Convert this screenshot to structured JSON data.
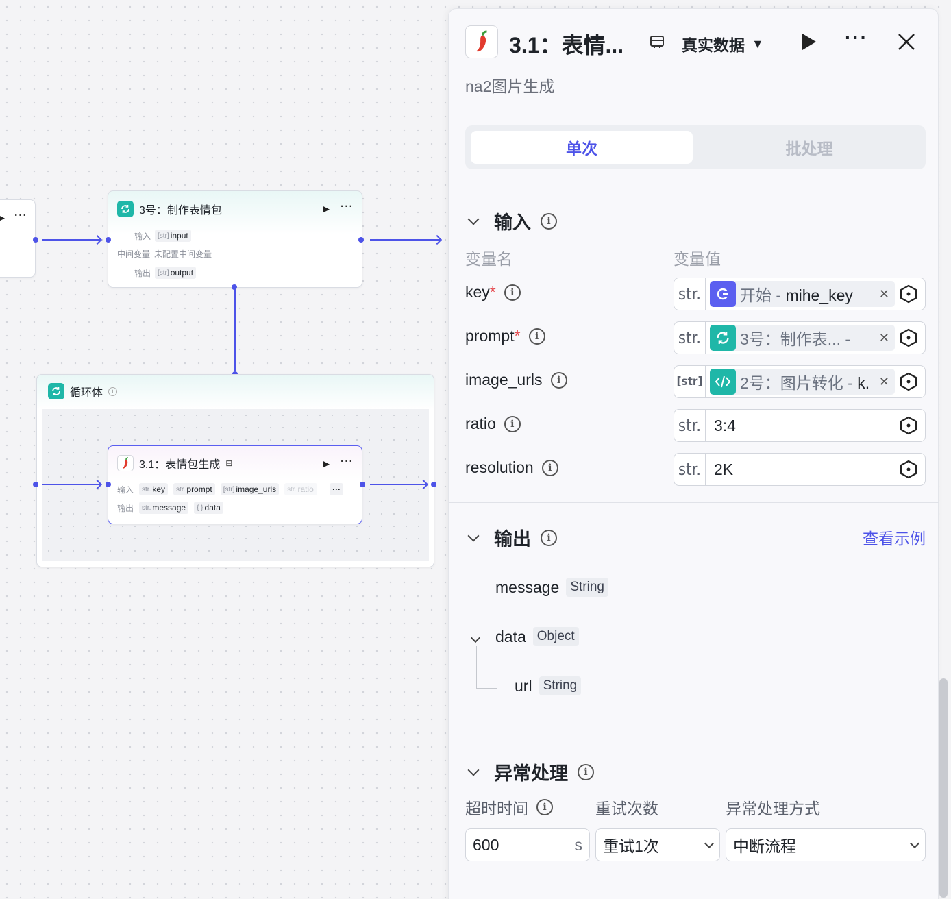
{
  "canvas": {
    "node3": {
      "title": "3号：制作表情包",
      "input_label": "输入",
      "input_tag_type": "[str]",
      "input_tag": "input",
      "midvar_label": "中间变量",
      "midvar_value": "未配置中间变量",
      "output_label": "输出",
      "output_tag_type": "[str]",
      "output_tag": "output"
    },
    "loop": {
      "title": "循环体"
    },
    "node31": {
      "title": "3.1：表情包生成",
      "input_label": "输入",
      "input_tags": [
        {
          "type": "str.",
          "name": "key"
        },
        {
          "type": "str.",
          "name": "prompt"
        },
        {
          "type": "[str]",
          "name": "image_urls"
        },
        {
          "type": "str.",
          "name": "ratio"
        }
      ],
      "output_label": "输出",
      "output_tags": [
        {
          "type": "str.",
          "name": "message"
        },
        {
          "type": "{ }",
          "name": "data"
        }
      ]
    }
  },
  "panel": {
    "title": "3.1：表情...",
    "subtitle": "na2图片生成",
    "data_mode": "真实数据",
    "tabs": {
      "single": "单次",
      "batch": "批处理"
    },
    "input_section": {
      "title": "输入",
      "col_name": "变量名",
      "col_value": "变量值",
      "rows": [
        {
          "name": "key",
          "required": "*",
          "type": "str.",
          "ref_source": "开始",
          "ref_sep": " - ",
          "ref_var": "mihe_key"
        },
        {
          "name": "prompt",
          "required": "*",
          "type": "str.",
          "ref_source": "3号：制作表...",
          "ref_sep": " - ",
          "ref_var": ""
        },
        {
          "name": "image_urls",
          "required": "",
          "type": "[str]",
          "ref_source": "2号：图片转化",
          "ref_sep": " - ",
          "ref_var": "k."
        },
        {
          "name": "ratio",
          "required": "",
          "type": "str.",
          "value": "3:4"
        },
        {
          "name": "resolution",
          "required": "",
          "type": "str.",
          "value": "2K"
        }
      ]
    },
    "output_section": {
      "title": "输出",
      "view_example": "查看示例",
      "fields": [
        {
          "name": "message",
          "type": "String"
        },
        {
          "name": "data",
          "type": "Object"
        },
        {
          "name": "url",
          "type": "String"
        }
      ]
    },
    "error_section": {
      "title": "异常处理",
      "timeout_label": "超时时间",
      "retry_label": "重试次数",
      "mode_label": "异常处理方式",
      "timeout_value": "600",
      "timeout_unit": "s",
      "retry_value": "重试1次",
      "mode_value": "中断流程"
    }
  },
  "colors": {
    "accent": "#4d53e8",
    "loop_icon": "#1fb7a8",
    "required": "#e5484d",
    "start_icon": "#5b5ff0"
  },
  "icons": [
    "chili-icon",
    "loop-icon",
    "start-icon",
    "code-icon",
    "info-icon",
    "play-icon",
    "more-icon",
    "close-icon",
    "variable-hex-icon",
    "chevron-down-icon",
    "data-mode-icon"
  ]
}
